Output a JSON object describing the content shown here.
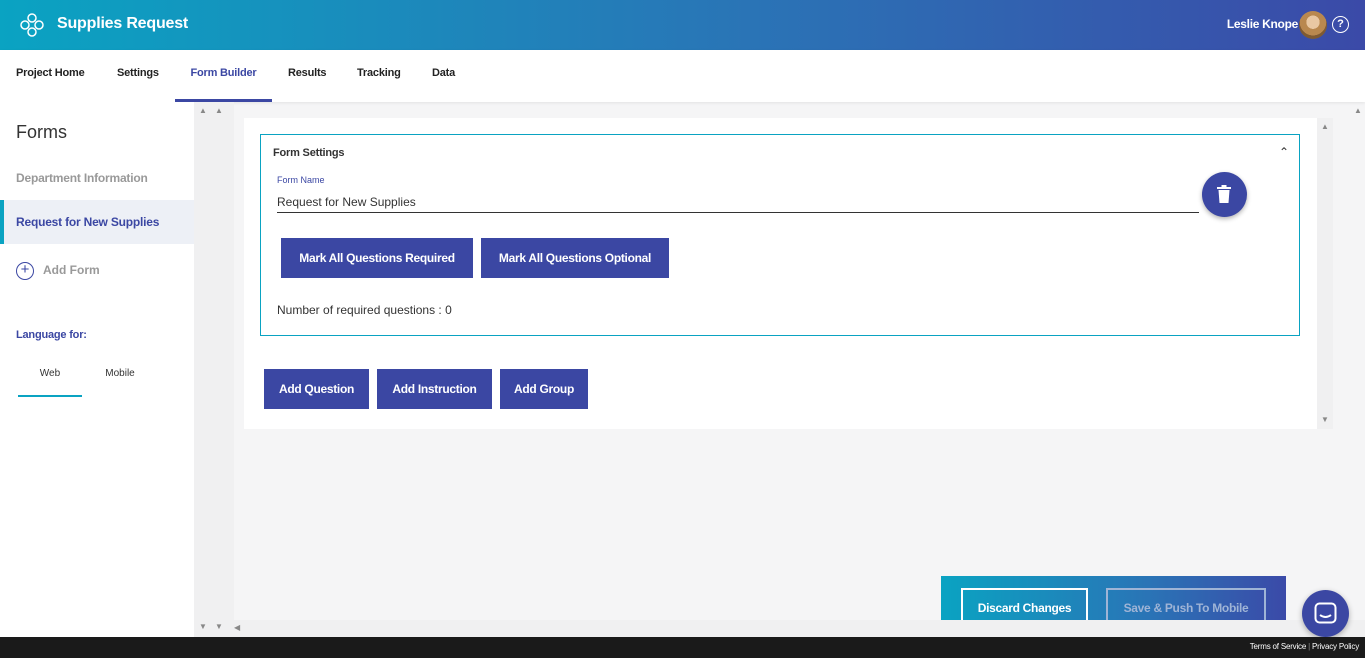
{
  "header": {
    "app_title": "Supplies Request",
    "user_name": "Leslie Knope",
    "logo_icon": "app-logo-icon",
    "help_icon": "?"
  },
  "nav": {
    "tabs": [
      {
        "label": "Project Home"
      },
      {
        "label": "Settings"
      },
      {
        "label": "Form Builder",
        "active": true
      },
      {
        "label": "Results"
      },
      {
        "label": "Tracking"
      },
      {
        "label": "Data"
      }
    ]
  },
  "sidebar": {
    "title": "Forms",
    "forms": [
      {
        "label": "Department Information"
      },
      {
        "label": "Request for New Supplies",
        "active": true
      }
    ],
    "add_form_label": "Add Form",
    "language_label": "Language for:",
    "language_tabs": [
      {
        "label": "Web",
        "active": true
      },
      {
        "label": "Mobile"
      }
    ]
  },
  "form_settings": {
    "title": "Form Settings",
    "form_name_label": "Form Name",
    "form_name_value": "Request for New Supplies",
    "mark_required_label": "Mark All Questions Required",
    "mark_optional_label": "Mark All Questions Optional",
    "required_count_text": "Number of required questions : 0"
  },
  "actions": {
    "add_question": "Add Question",
    "add_instruction": "Add Instruction",
    "add_group": "Add Group"
  },
  "action_bar": {
    "discard_label": "Discard Changes",
    "push_label": "Save & Push To Mobile"
  },
  "footer": {
    "terms": "Terms of Service",
    "privacy": "Privacy Policy"
  },
  "colors": {
    "accent": "#3b47a3",
    "teal": "#0aa3c2"
  }
}
